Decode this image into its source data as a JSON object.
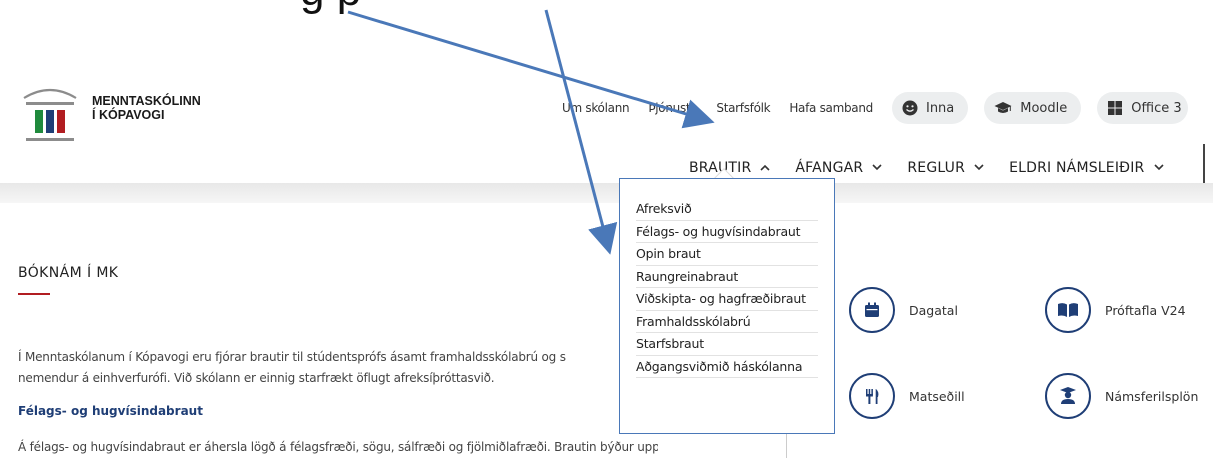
{
  "top_fragment": "g p",
  "logo": {
    "line1": "MENNTASKÓLINN",
    "line2": "Í KÓPAVOGI"
  },
  "util_nav": {
    "links": [
      "Um skólann",
      "Þjónusta",
      "Starfsfólk",
      "Hafa samband"
    ],
    "pills": [
      {
        "label": "Inna",
        "icon": "smiley-icon"
      },
      {
        "label": "Moodle",
        "icon": "graduation-cap-icon"
      },
      {
        "label": "Office 3",
        "icon": "office-grid-icon"
      }
    ]
  },
  "main_nav": {
    "items": [
      {
        "label": "BRAUTIR",
        "chevron": "^"
      },
      {
        "label": "ÁFANGAR",
        "chevron": "v"
      },
      {
        "label": "REGLUR",
        "chevron": "v"
      },
      {
        "label": "ELDRI NÁMSLEIÐIR",
        "chevron": "v"
      }
    ]
  },
  "dropdown": {
    "items": [
      "Afreksvið",
      "Félags- og hugvísindabraut",
      "Opin braut",
      "Raungreinabraut",
      "Viðskipta- og hagfræðibraut",
      "Framhaldsskólabrú",
      "Starfsbraut",
      "Aðgangsviðmið háskólanna"
    ]
  },
  "content": {
    "title": "BÓKNÁM Í MK",
    "para1_line1": "Í Menntaskólanum í Kópavogi eru fjórar brautir til stúdentsprófs ásamt framhaldsskólabrú og s",
    "para1_line2": "nemendur á einhverfurófi. Við skólann er einnig starfrækt öflugt afreksíþróttasvið.",
    "subheading": "Félags- og hugvísindabraut",
    "para2": "Á félags- og hugvísindabraut er áhersla lögð á félagsfræði, sögu, sálfræði og fjölmiðlafræði. Brautin býður upp"
  },
  "quick_links": [
    {
      "label": "Dagatal",
      "icon": "calendar-icon"
    },
    {
      "label": "Próftafla V24",
      "icon": "open-book-icon"
    },
    {
      "label": "Matseðill",
      "icon": "fork-knife-icon"
    },
    {
      "label": "Námsferilsplön",
      "icon": "student-icon"
    }
  ],
  "colors": {
    "navy": "#1f3e76",
    "accent_red": "#b11d21",
    "arrow_blue": "#4a78b8",
    "pill_grey": "#eceeef"
  }
}
